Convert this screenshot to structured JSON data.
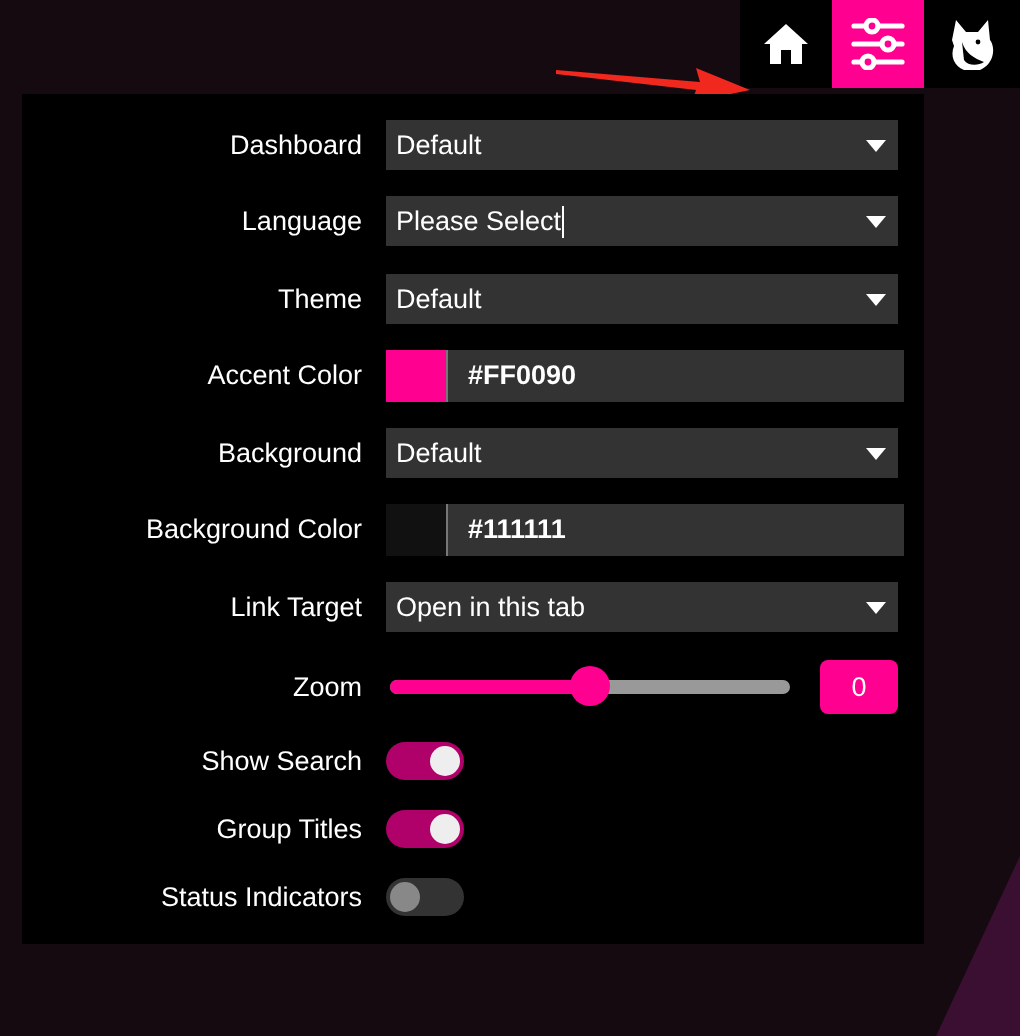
{
  "nav": [
    {
      "kind": "home",
      "selected": false
    },
    {
      "kind": "settings",
      "selected": true
    },
    {
      "kind": "fox",
      "selected": false
    }
  ],
  "settings": [
    {
      "kind": "select",
      "label": "Dashboard",
      "value": "Default",
      "focused": false
    },
    {
      "kind": "select",
      "label": "Language",
      "value": "Please Select",
      "focused": true
    },
    {
      "kind": "select",
      "label": "Theme",
      "value": "Default",
      "focused": false
    },
    {
      "kind": "color",
      "label": "Accent Color",
      "value": "#FF0090",
      "color": "#ff0090"
    },
    {
      "kind": "select",
      "label": "Background",
      "value": "Default",
      "focused": false
    },
    {
      "kind": "color",
      "label": "Background Color",
      "value": "#111111",
      "color": "#111111"
    },
    {
      "kind": "select",
      "label": "Link Target",
      "value": "Open in this tab",
      "focused": false
    },
    {
      "kind": "slider",
      "label": "Zoom",
      "level": 0.5,
      "value": "0"
    },
    {
      "kind": "toggle",
      "label": "Show Search",
      "on": true
    },
    {
      "kind": "toggle",
      "label": "Group Titles",
      "on": true
    },
    {
      "kind": "toggle",
      "label": "Status Indicators",
      "on": false
    }
  ]
}
